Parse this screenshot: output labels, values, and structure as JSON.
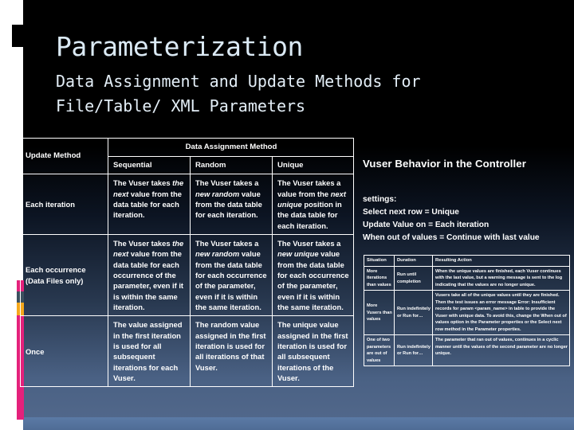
{
  "slide": {
    "title": "Parameterization",
    "subtitle_line1": "Data Assignment and Update Methods for",
    "subtitle_line2": "File/Table/ XML Parameters"
  },
  "colors": {
    "accent_pink": "#E4217B",
    "accent_slate": "#3C5160",
    "accent_orange": "#F5A81C",
    "title_text": "#DBEAF5",
    "background_top": "#000000",
    "background_bottom": "#53698C",
    "bottom_bar": "#5B7AA6",
    "border": "#FFFFFF"
  },
  "color_strip": [
    {
      "name": "pink-segment-top",
      "color": "#E4217B",
      "height": 14
    },
    {
      "name": "slate-segment",
      "color": "#3C5160",
      "height": 14
    },
    {
      "name": "orange-segment",
      "color": "#F5A81C",
      "height": 16
    },
    {
      "name": "pink-segment-long",
      "color": "#E4217B",
      "height": 131
    }
  ],
  "main_table": {
    "corner_label": "Update Method",
    "group_header": "Data Assignment Method",
    "columns": [
      "Sequential",
      "Random",
      "Unique"
    ],
    "rows": [
      {
        "label": "Each iteration",
        "cells": [
          {
            "pre": "The Vuser takes ",
            "em": "the next",
            "post": " value from the data table for each iteration."
          },
          {
            "pre": "The Vuser takes a ",
            "em": "new random",
            "post": " value from the data table for each iteration."
          },
          {
            "pre": "The Vuser takes a value from the ",
            "em": "next unique",
            "post": " position in the data table for each iteration."
          }
        ]
      },
      {
        "label": "Each occurrence (Data Files only)",
        "cells": [
          {
            "pre": "The Vuser takes ",
            "em": "the next",
            "post": " value from the data table for each occurrence of the parameter, even if it is within the same iteration."
          },
          {
            "pre": "The Vuser takes a ",
            "em": "new random",
            "post": " value from the data table for each occurrence of the parameter, even if it is within the same iteration."
          },
          {
            "pre": "The Vuser takes a ",
            "em": "new unique",
            "post": " value from the data table for each occurrence of the parameter, even if it is within the same iteration."
          }
        ]
      },
      {
        "label": "Once",
        "cells": [
          {
            "pre": "The value assigned in the first iteration is used for all subsequent iterations for each Vuser.",
            "em": "",
            "post": ""
          },
          {
            "pre": "The random value assigned in the first iteration is used for all iterations of that Vuser.",
            "em": "",
            "post": ""
          },
          {
            "pre": "The unique value assigned in the first iteration is used for all subsequent iterations of the Vuser.",
            "em": "",
            "post": ""
          }
        ]
      }
    ]
  },
  "right_panel": {
    "heading": "Vuser Behavior in the Controller",
    "settings": [
      "settings:",
      "Select next row = Unique",
      "Update Value on = Each iteration",
      "When out of values = Continue with last value"
    ]
  },
  "mini_table": {
    "columns": [
      "Situation",
      "Duration",
      "Resulting Action"
    ],
    "rows": [
      {
        "situation": "More iterations than values",
        "duration": "Run until completion",
        "action": "When the unique values are finished, each Vuser continues with the last value, but a warning message is sent to the log indicating that the values are no longer unique."
      },
      {
        "situation": "More Vusers than values",
        "duration": "Run indefinitely or Run for…",
        "action": "Vusers take all of the unique values until they are finished. Then the test issues an error message Error: Insufficient records for param <param_name> in table to provide the Vuser with unique data. To avoid this, change the When out of values option in the Parameter properties or the Select next row method in the Parameter properties."
      },
      {
        "situation": "One of two parameters are out of values",
        "duration": "Run indefinitely or Run for…",
        "action": "The parameter that ran out of values, continues in a cyclic manner until the values of the second parameter are no longer unique."
      }
    ]
  }
}
